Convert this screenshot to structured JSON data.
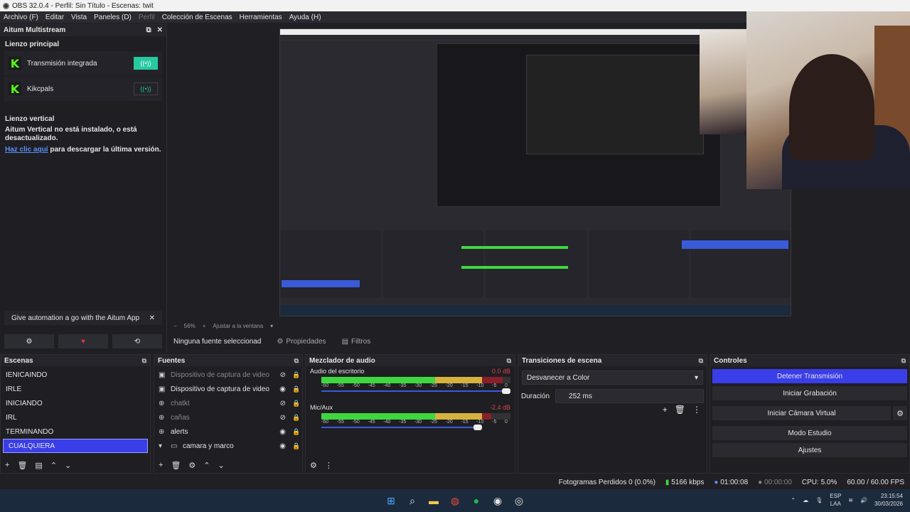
{
  "window": {
    "title": "OBS 32.0.4 - Perfil: Sin Título - Escenas: twit"
  },
  "menu": [
    "Archivo (F)",
    "Editar",
    "Vista",
    "Paneles (D)",
    "Perfil",
    "Colección de Escenas",
    "Herramientas",
    "Ayuda (H)"
  ],
  "multistream": {
    "title": "Aitum Multistream",
    "main_canvas": "Lienzo principal",
    "outputs": [
      {
        "label": "Transmisión integrada",
        "active": true
      },
      {
        "label": "Kikcpals",
        "active": false
      }
    ],
    "vertical_canvas": "Lienzo vertical",
    "vertical_note": "Aitum Vertical no está instalado, o está desactualizado.",
    "link_text": "Haz clic aquí",
    "link_suffix": " para descargar la última versión.",
    "banner": "Give automation a go with the Aitum App"
  },
  "preview": {
    "zoom": "56%",
    "fit_label": "Ajustar a la ventana",
    "no_source": "Ninguna fuente seleccionad",
    "properties": "Propiedades",
    "filters": "Filtros"
  },
  "scenes": {
    "title": "Escenas",
    "items": [
      "IENICAINDO",
      "IRLE",
      "INICIANDO",
      "IRL",
      "TERMINANDO",
      "CUALQUIERA"
    ],
    "selected": "CUALQUIERA"
  },
  "sources": {
    "title": "Fuentes",
    "items": [
      {
        "label": "Dispositivo de captura de video",
        "visible": false,
        "icon": "camera-icon"
      },
      {
        "label": "Dispositivo de captura de video",
        "visible": true,
        "icon": "camera-icon"
      },
      {
        "label": "chatkt",
        "visible": false,
        "icon": "globe-icon"
      },
      {
        "label": "cañas",
        "visible": false,
        "icon": "globe-icon"
      },
      {
        "label": "alerts",
        "visible": true,
        "icon": "globe-icon"
      },
      {
        "label": "camara y marco",
        "visible": true,
        "icon": "folder-icon"
      }
    ]
  },
  "mixer": {
    "title": "Mezclador de audio",
    "channels": [
      {
        "name": "Audio del escritorio",
        "db": "0.0 dB",
        "level": 0.96,
        "volume": 1.0
      },
      {
        "name": "Mic/Aux",
        "db": "-2.4 dB",
        "level": 0.9,
        "volume": 0.85
      }
    ],
    "ticks": [
      "-60",
      "-55",
      "-50",
      "-45",
      "-40",
      "-35",
      "-30",
      "-25",
      "-20",
      "-15",
      "-10",
      "-5",
      "0"
    ]
  },
  "transitions": {
    "title": "Transiciones de escena",
    "selected": "Desvanecer a Color",
    "duration_label": "Duración",
    "duration": "252 ms"
  },
  "controls": {
    "title": "Controles",
    "stream": "Detener Transmisión",
    "record": "Iniciar Grabación",
    "virtual_cam": "Iniciar Cámara Virtual",
    "studio": "Modo Estudio",
    "settings": "Ajustes"
  },
  "status": {
    "dropped": "Fotogramas Perdidos 0 (0.0%)",
    "bitrate": "5166 kbps",
    "stream_time": "01:00:08",
    "rec_time": "00:00:00",
    "cpu": "CPU: 5.0%",
    "fps": "60.00 / 60.00 FPS"
  },
  "taskbar": {
    "lang_top": "ESP",
    "lang_bottom": "LAA",
    "time": "23:15:54",
    "date": "30/03/2026"
  }
}
